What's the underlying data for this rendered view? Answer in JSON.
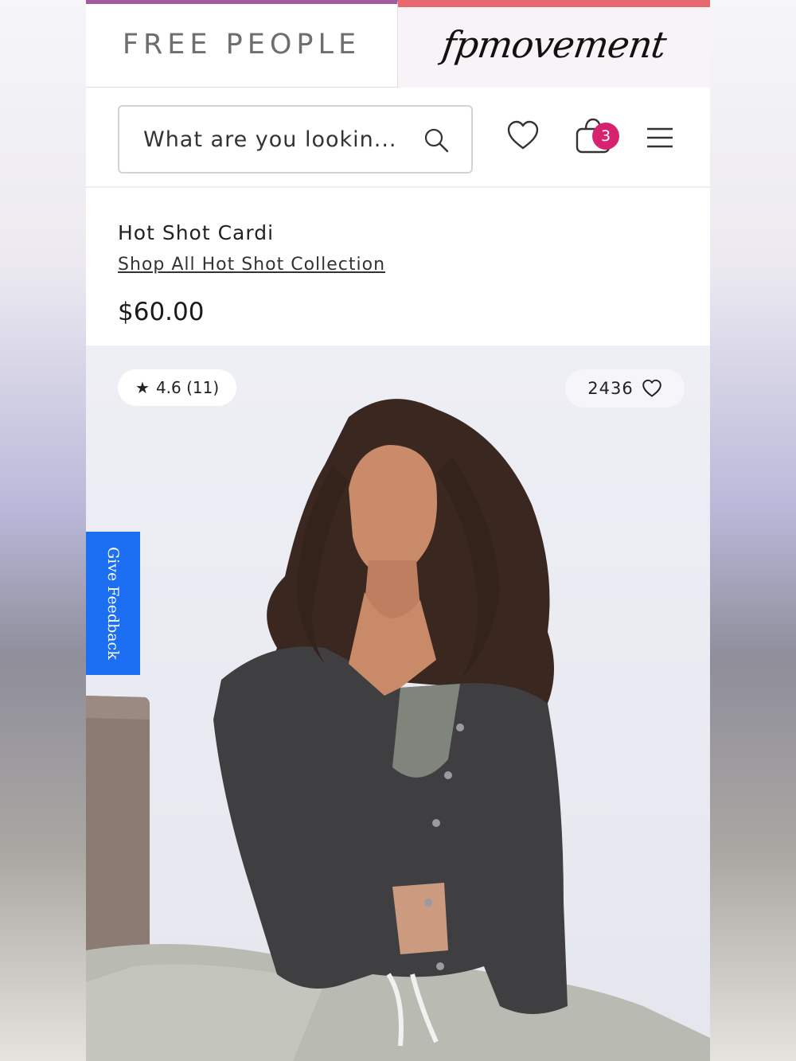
{
  "brand": {
    "main_logo": "FREE PEOPLE",
    "movement_logo": "fpmovement"
  },
  "search": {
    "placeholder": "What are you lookin..."
  },
  "header": {
    "cart_count": "3",
    "icons": [
      "search-icon",
      "heart-icon",
      "shopping-bag-icon",
      "hamburger-menu-icon"
    ]
  },
  "product": {
    "title": "Hot Shot Cardi",
    "collection_link": "Shop All Hot Shot Collection",
    "price": "$60.00",
    "rating": "4.6 (11)",
    "favorites": "2436"
  },
  "feedback": {
    "label": "Give Feedback"
  },
  "colors": {
    "fp_accent": "#a25b9f",
    "fpm_accent": "#e8686f",
    "badge": "#d7236f",
    "feedback": "#1c6ff2"
  }
}
